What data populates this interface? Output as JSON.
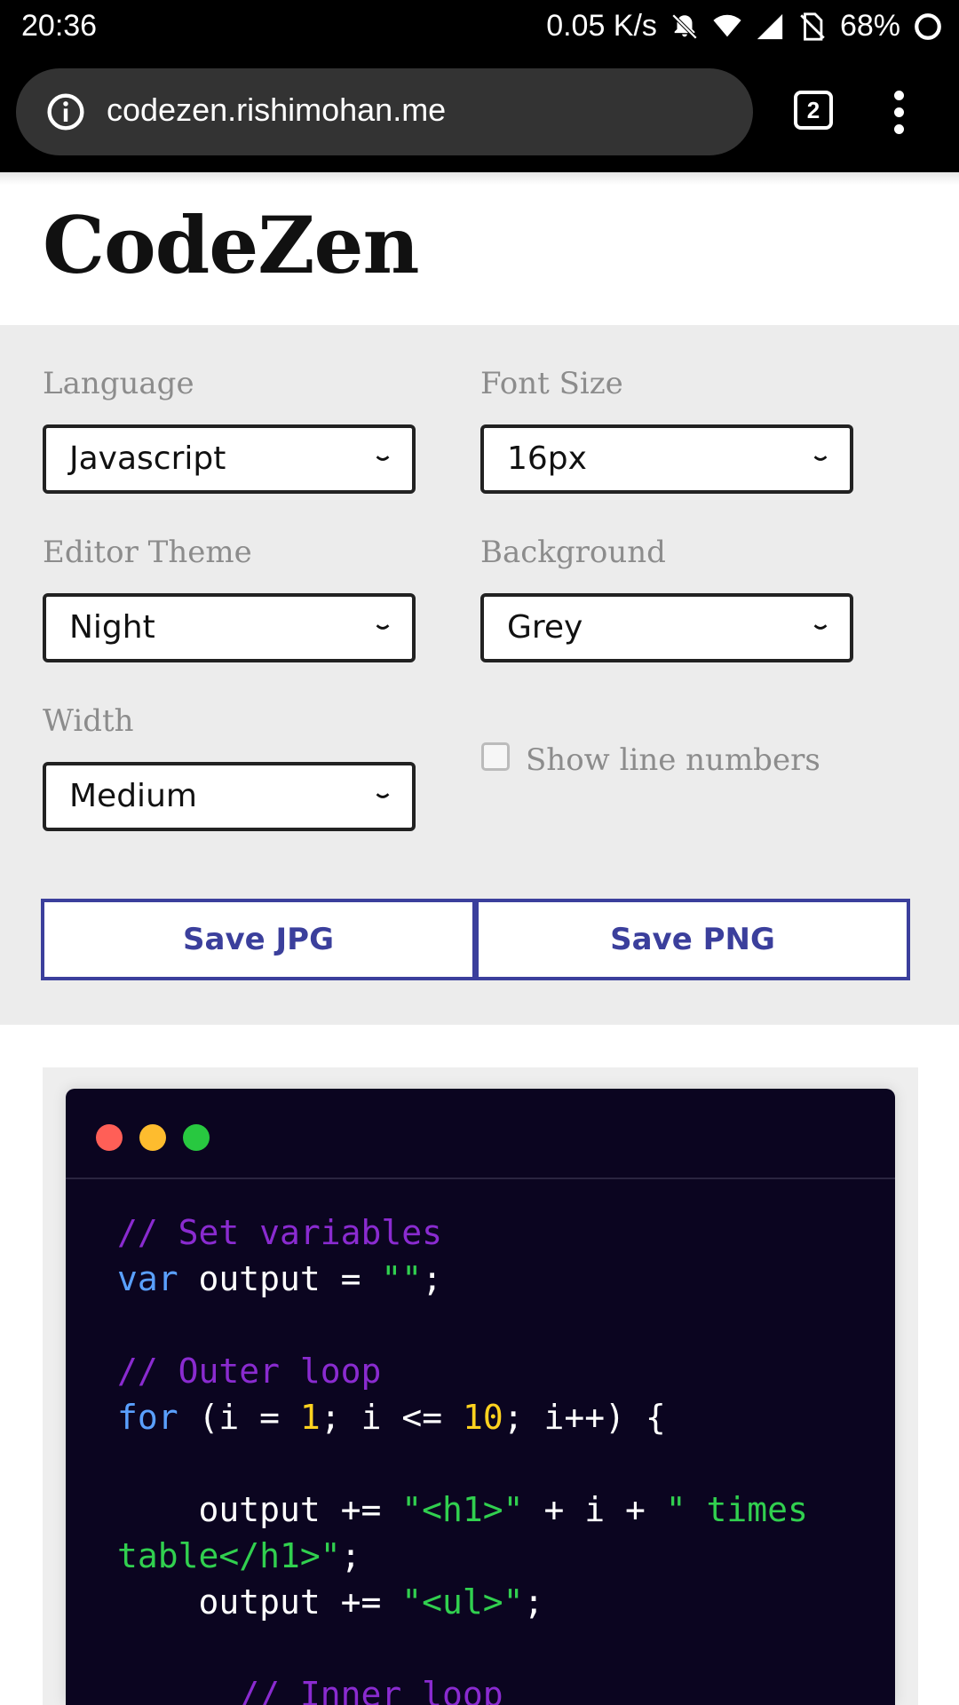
{
  "status_bar": {
    "time": "20:36",
    "net_speed": "0.05 K/s",
    "battery": "68%"
  },
  "browser": {
    "url": "codezen.rishimohan.me",
    "tab_count": "2"
  },
  "page": {
    "title": "CodeZen"
  },
  "controls": {
    "language": {
      "label": "Language",
      "value": "Javascript"
    },
    "font_size": {
      "label": "Font Size",
      "value": "16px"
    },
    "editor_theme": {
      "label": "Editor Theme",
      "value": "Night"
    },
    "background": {
      "label": "Background",
      "value": "Grey"
    },
    "width": {
      "label": "Width",
      "value": "Medium"
    },
    "line_numbers": {
      "label": "Show line numbers",
      "checked": false
    },
    "save_jpg": "Save JPG",
    "save_png": "Save PNG"
  },
  "window_dots": [
    "#ff5f57",
    "#febc2e",
    "#28c840"
  ],
  "code_lines": [
    [
      {
        "t": "// Set variables",
        "c": "c"
      }
    ],
    [
      {
        "t": "var",
        "c": "k"
      },
      {
        "t": " output = ",
        "c": "p"
      },
      {
        "t": "\"\"",
        "c": "s"
      },
      {
        "t": ";",
        "c": "p"
      }
    ],
    [],
    [
      {
        "t": "// Outer loop",
        "c": "c"
      }
    ],
    [
      {
        "t": "for",
        "c": "k"
      },
      {
        "t": " (i = ",
        "c": "p"
      },
      {
        "t": "1",
        "c": "n"
      },
      {
        "t": "; i <= ",
        "c": "p"
      },
      {
        "t": "10",
        "c": "n"
      },
      {
        "t": "; i++) {",
        "c": "p"
      }
    ],
    [],
    [
      {
        "t": "    output += ",
        "c": "p"
      },
      {
        "t": "\"<h1>\"",
        "c": "s"
      },
      {
        "t": " + i + ",
        "c": "p"
      },
      {
        "t": "\" times",
        "c": "s"
      }
    ],
    [
      {
        "t": "table</h1>\"",
        "c": "s"
      },
      {
        "t": ";",
        "c": "p"
      }
    ],
    [
      {
        "t": "    output += ",
        "c": "p"
      },
      {
        "t": "\"<ul>\"",
        "c": "s"
      },
      {
        "t": ";",
        "c": "p"
      }
    ],
    [],
    [
      {
        "t": "      // Inner loop",
        "c": "c"
      }
    ]
  ]
}
